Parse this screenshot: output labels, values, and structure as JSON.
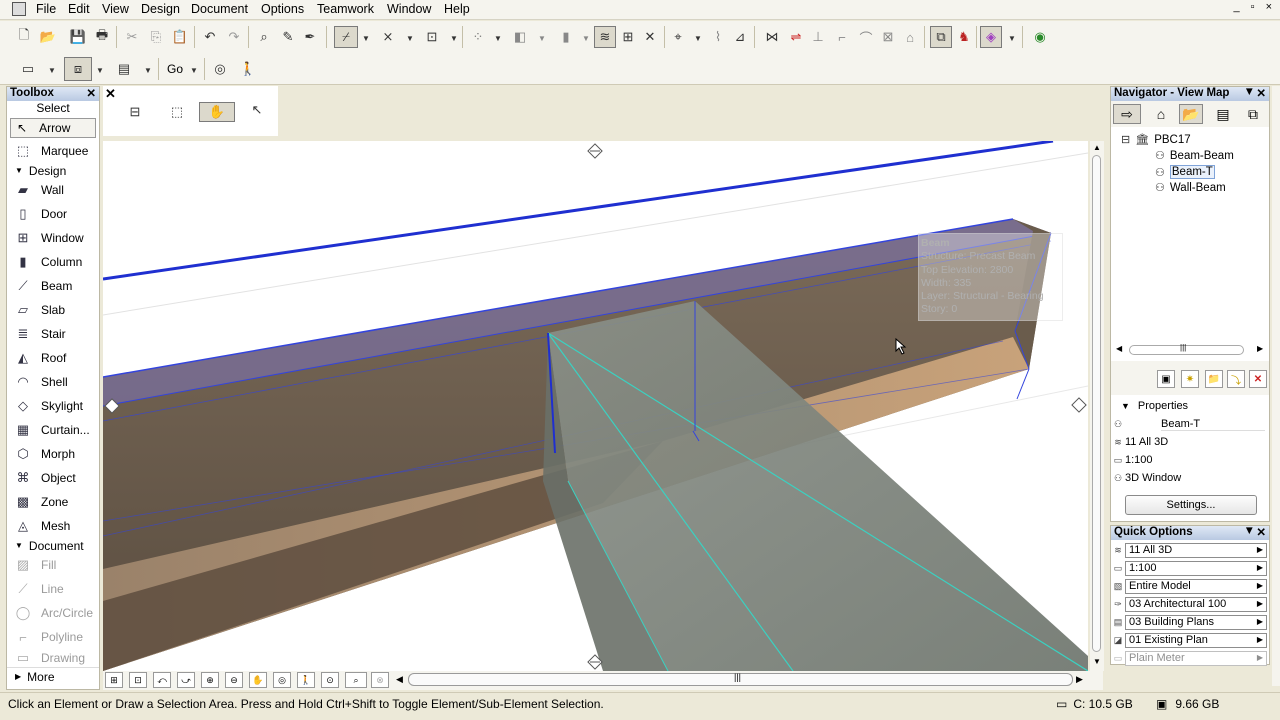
{
  "menu": [
    "File",
    "Edit",
    "View",
    "Design",
    "Document",
    "Options",
    "Teamwork",
    "Window",
    "Help"
  ],
  "window_controls": "_ ▫ ×",
  "toolbar2": {
    "go_label": "Go"
  },
  "toolbox": {
    "title": "Toolbox",
    "select_label": "Select",
    "arrow_label": "Arrow",
    "marquee_label": "Marquee",
    "design_group": "Design",
    "design_tools": [
      "Wall",
      "Door",
      "Window",
      "Column",
      "Beam",
      "Slab",
      "Stair",
      "Roof",
      "Shell",
      "Skylight",
      "Curtain...",
      "Morph",
      "Object",
      "Zone",
      "Mesh"
    ],
    "document_group": "Document",
    "document_tools": [
      "Fill",
      "Line",
      "Arc/Circle",
      "Polyline",
      "Drawing"
    ],
    "more_label": "More"
  },
  "tooltip": {
    "title": "Beam",
    "lines": [
      "Structure: Precast Beam",
      "Top Elevation: 2800",
      "Width: 335",
      "Layer: Structural - Bearing",
      "Story: 0"
    ]
  },
  "navigator": {
    "title": "Navigator - View Map",
    "root": "PBC17",
    "items": [
      "Beam-Beam",
      "Beam-T",
      "Wall-Beam"
    ],
    "selected": "Beam-T",
    "scroll_label": "|||",
    "properties_label": "Properties",
    "prop_name": "Beam-T",
    "prop_layer": "11 All 3D",
    "prop_scale": "1:100",
    "prop_window": "3D Window",
    "settings_label": "Settings..."
  },
  "quick_options": {
    "title": "Quick Options",
    "rows": [
      "11 All 3D",
      "1:100",
      "Entire Model",
      "03 Architectural 100",
      "03 Building Plans",
      "01 Existing Plan",
      "Plain Meter"
    ]
  },
  "viewport": {
    "scroll_label": "|||"
  },
  "status": {
    "message": "Click an Element or Draw a Selection Area. Press and Hold Ctrl+Shift to Toggle Element/Sub-Element Selection.",
    "disk_c": "C: 10.5 GB",
    "memory": "9.66 GB"
  },
  "colors": {
    "selection_blue": "#1f2fd0",
    "beam_cyan": "#3ad2c2",
    "panel_header": "#b9c9e2",
    "chrome": "#f5f4ee"
  }
}
